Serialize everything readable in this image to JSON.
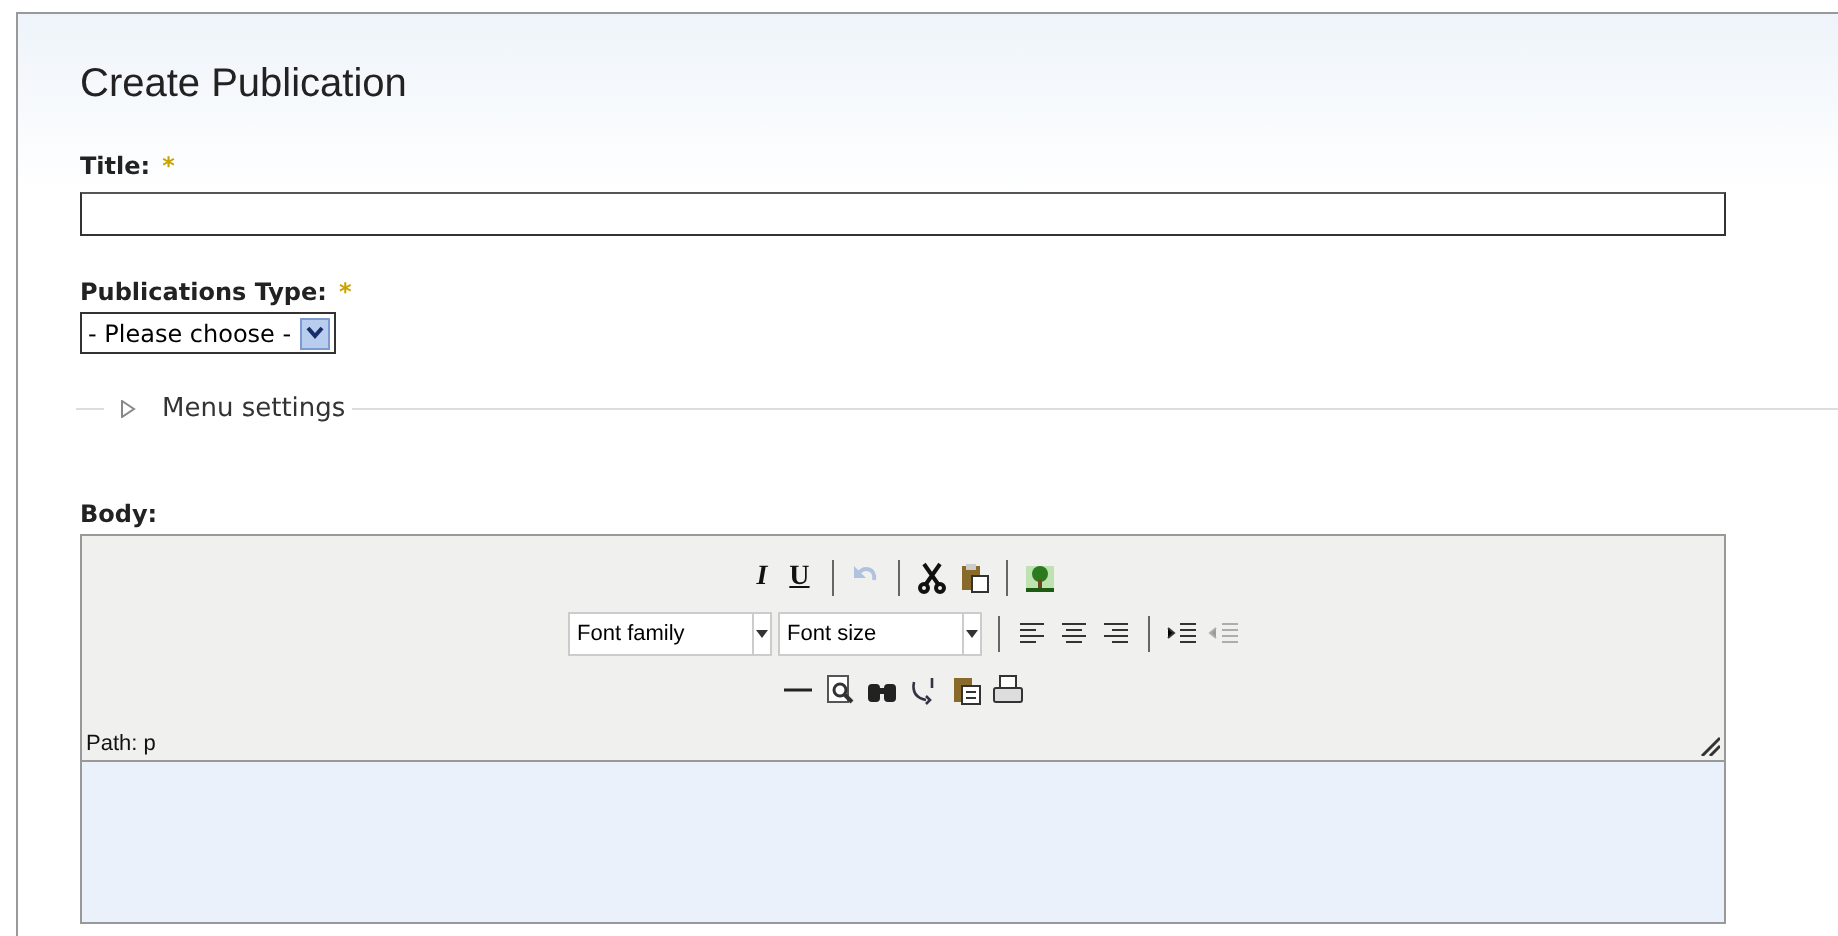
{
  "heading": "Create Publication",
  "title_field": {
    "label": "Title:",
    "required_mark": "*"
  },
  "type_field": {
    "label": "Publications Type:",
    "required_mark": "*",
    "value": "- Please choose -"
  },
  "menu_settings": {
    "label": "Menu settings",
    "expanded": false
  },
  "body": {
    "label": "Body:",
    "path": "Path: p",
    "toolbar": [
      [
        {
          "kind": "glyph",
          "label": "I"
        },
        {
          "kind": "glyph",
          "label": "U"
        },
        {
          "kind": "separator"
        },
        {
          "kind": "icon",
          "disabled": true
        },
        {
          "kind": "separator"
        },
        {
          "kind": "icon",
          "disabled": false
        },
        {
          "kind": "icon",
          "disabled": false
        },
        {
          "kind": "separator"
        },
        {
          "kind": "icon",
          "disabled": false
        }
      ],
      [
        {
          "kind": "select",
          "label": "Font family"
        },
        {
          "kind": "select",
          "label": "Font size"
        },
        {
          "kind": "separator"
        },
        {
          "kind": "icon",
          "disabled": false
        },
        {
          "kind": "icon",
          "disabled": false
        },
        {
          "kind": "icon",
          "disabled": false
        },
        {
          "kind": "separator"
        },
        {
          "kind": "icon",
          "disabled": false
        },
        {
          "kind": "icon",
          "disabled": true
        }
      ],
      [
        {
          "kind": "icon",
          "disabled": false
        },
        {
          "kind": "icon",
          "disabled": false
        },
        {
          "kind": "icon",
          "disabled": false
        },
        {
          "kind": "icon",
          "disabled": false
        },
        {
          "kind": "icon",
          "disabled": false
        },
        {
          "kind": "icon",
          "disabled": false
        }
      ]
    ]
  }
}
